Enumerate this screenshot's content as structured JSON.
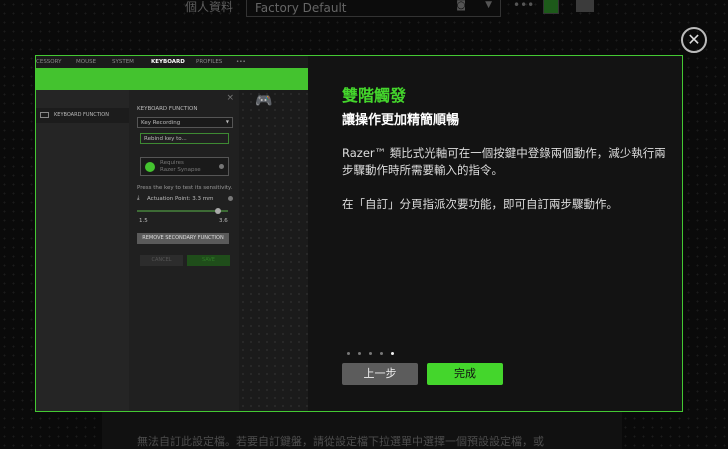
{
  "topbar": {
    "profile_label": "個人資料",
    "profile_value": "Factory Default",
    "more": "•••"
  },
  "modal": {
    "close": "✕",
    "screenshot": {
      "tabs": [
        "CESSORY",
        "MOUSE",
        "SYSTEM",
        "KEYBOARD",
        "PROFILES",
        "•••"
      ],
      "sidebar_item": "KEYBOARD FUNCTION",
      "panel_title": "KEYBOARD FUNCTION",
      "dropdown": "Key Recording",
      "rebind": "Rebind key to...",
      "requires_1": "Requires",
      "requires_2": "Razer Synapse",
      "hint": "Press the key to test its sensitivity.",
      "actuation": "Actuation Point: 3.3 mm",
      "slider_min": "1.5",
      "slider_max": "3.6",
      "slider_value": 3.3,
      "remove": "REMOVE SECONDARY FUNCTION",
      "cancel": "CANCEL",
      "save": "SAVE"
    },
    "title": "雙階觸發",
    "subtitle": "讓操作更加精簡順暢",
    "para1": "Razer™ 類比式光軸可在一個按鍵中登錄兩個動作，減少執行兩步驟動作時所需要輸入的指令。",
    "para2": "在「自訂」分頁指派次要功能，即可自訂兩步驟動作。",
    "page_current": 5,
    "page_total": 5,
    "back": "上一步",
    "done": "完成"
  },
  "bottom_text": "無法自訂此設定檔。若要自訂鍵盤，請從設定檔下拉選單中選擇一個預設設定檔，或"
}
